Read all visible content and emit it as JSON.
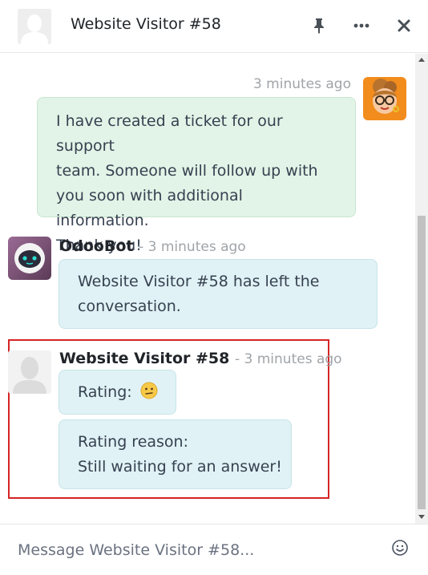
{
  "header": {
    "title": "Website Visitor #58",
    "icons": [
      "person-avatar-icon",
      "pin-icon",
      "more-icon",
      "close-icon"
    ]
  },
  "thread": {
    "agent_message": {
      "timestamp": "3 minutes ago",
      "lines": [
        "I have created a ticket for our support",
        "team. Someone will follow up with",
        "you soon with additional information.",
        "Thank you!"
      ]
    },
    "bot_message": {
      "author": "OdooBot",
      "timestamp": "- 3 minutes ago",
      "lines": [
        "Website Visitor #58 has left the",
        "conversation."
      ]
    },
    "visitor_message": {
      "author": "Website Visitor #58",
      "timestamp": "- 3 minutes ago",
      "rating_label": "Rating:",
      "reason_lines": [
        "Rating reason:",
        "Still waiting for an answer!"
      ]
    }
  },
  "composer": {
    "placeholder": "Message Website Visitor #58..."
  },
  "colors": {
    "agent_bubble": "#e2f4e7",
    "other_bubble": "#e0f2f5",
    "highlight_border": "#d62424"
  }
}
